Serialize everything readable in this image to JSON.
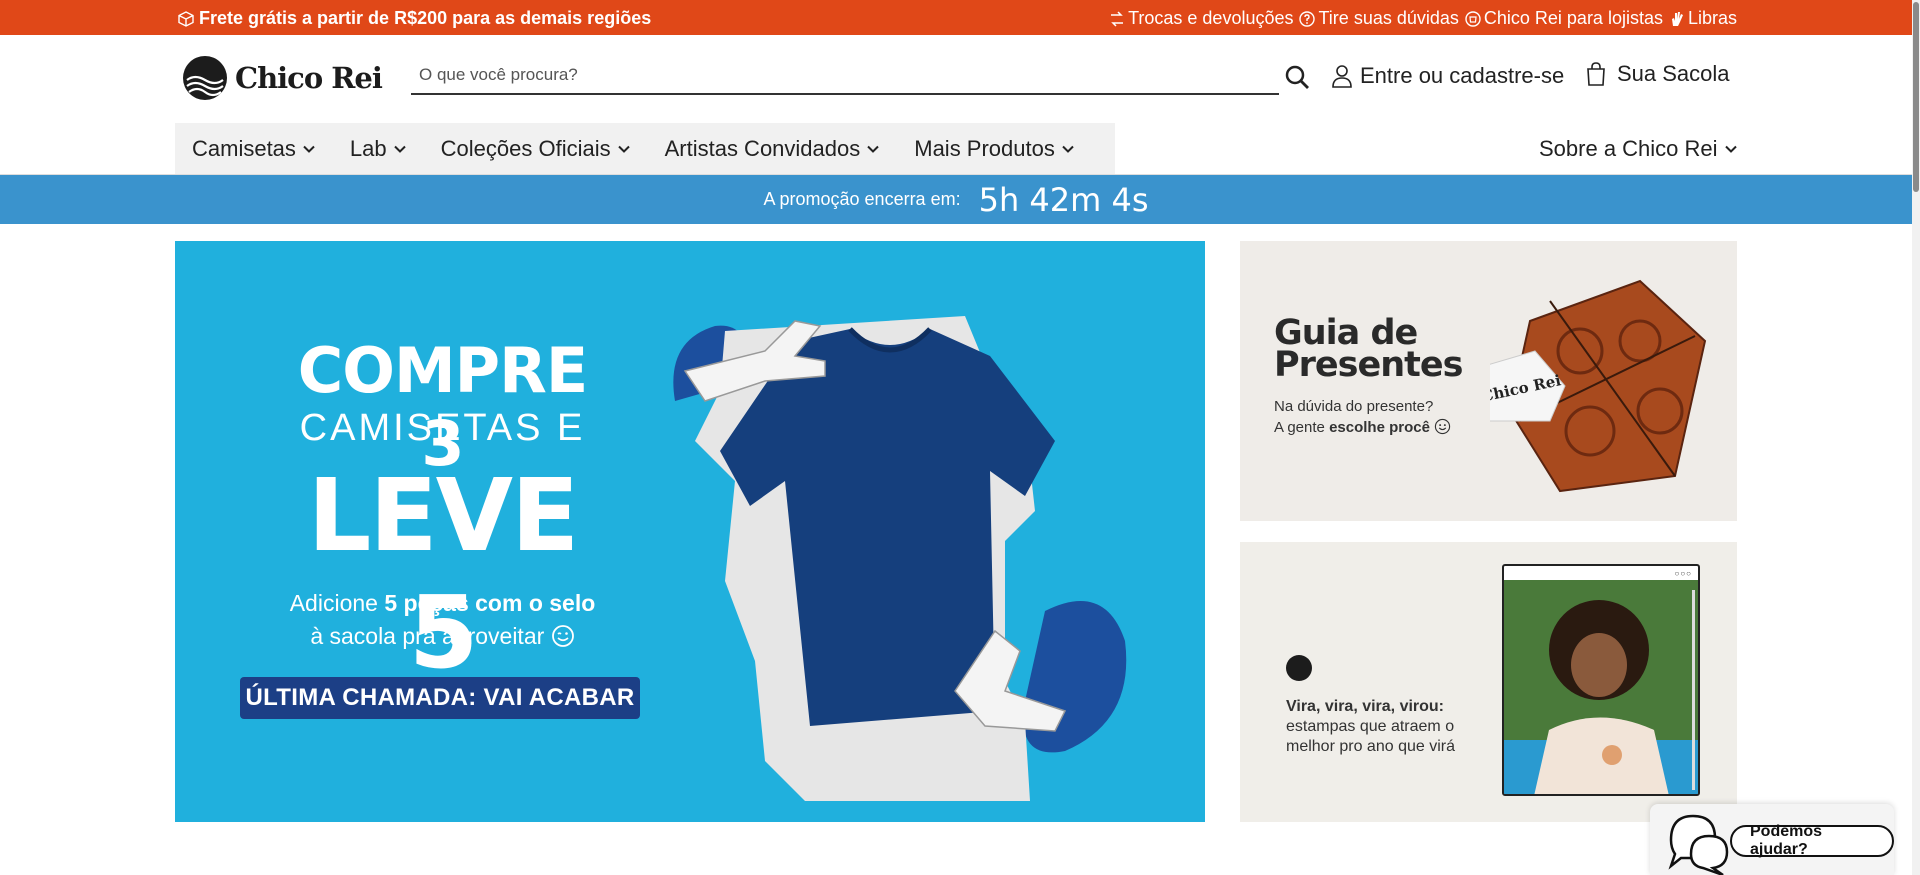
{
  "topbar": {
    "shipping": "Frete grátis a partir de R$200 para as demais regiões",
    "links": [
      {
        "label": "Trocas e devoluções",
        "icon": "exchange-icon"
      },
      {
        "label": "Tire suas dúvidas",
        "icon": "question-icon"
      },
      {
        "label": "Chico Rei para lojistas",
        "icon": "store-icon"
      },
      {
        "label": "Libras",
        "icon": "hand-sign-icon"
      }
    ],
    "color": "#e04818"
  },
  "header": {
    "brand": "Chico Rei",
    "search_placeholder": "O que você procura?",
    "login_label": "Entre ou cadastre-se",
    "bag_label": "Sua Sacola"
  },
  "nav": {
    "items": [
      "Camisetas",
      "Lab",
      "Coleções Oficiais",
      "Artistas Convidados",
      "Mais Produtos"
    ],
    "about": "Sobre a Chico Rei"
  },
  "countdown": {
    "label": "A promoção encerra em:",
    "timer": "5h 42m 4s",
    "color": "#3a93cd"
  },
  "main_banner": {
    "line1": "COMPRE 3",
    "line2": "CAMISETAS E",
    "line3": "LEVE 5",
    "desc_a": "Adicione ",
    "desc_b": "5 peças com o selo",
    "desc_c": "à sacola pra aproveitar",
    "badge": "ÚLTIMA CHAMADA: VAI ACABAR",
    "color": "#20b0dd"
  },
  "gift_banner": {
    "title_1": "Guia de",
    "title_2": "Presentes",
    "sub_1": "Na dúvida do presente?",
    "sub_2a": "A gente ",
    "sub_2b": "escolhe procê",
    "tag": "Chico Rei"
  },
  "collection_banner": {
    "headline": "Vira, vira, vira, virou:",
    "text": "estampas que atraem o melhor pro ano que virá"
  },
  "help": {
    "label": "Podemos ajudar?"
  }
}
